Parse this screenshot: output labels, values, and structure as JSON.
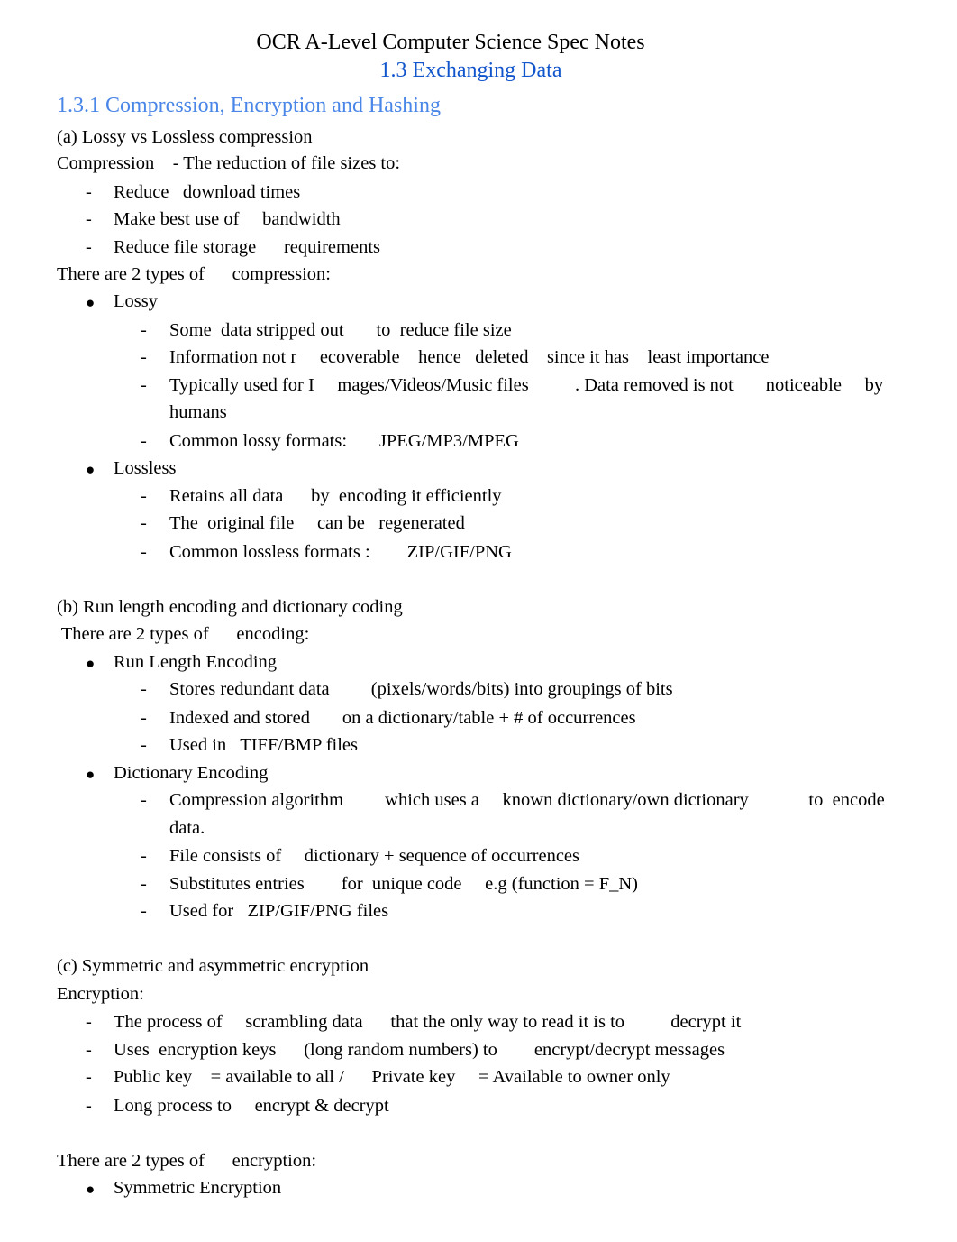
{
  "header": {
    "title": "OCR A-Level Computer Science Spec Notes",
    "subtitle": "1.3 Exchanging Data",
    "section_heading": "1.3.1 Compression, Encryption and Hashing"
  },
  "section_a": {
    "heading": "(a) Lossy vs Lossless compression",
    "intro": "Compression    - The reduction of file sizes to:",
    "reasons": [
      "Reduce   download times",
      "Make best use of     bandwidth",
      "Reduce file storage      requirements"
    ],
    "types_intro": "There are 2 types of      compression:",
    "lossy": {
      "label": "Lossy",
      "points": [
        "Some  data stripped out       to  reduce file size",
        "Information not r     ecoverable    hence   deleted    since it has    least importance",
        "Typically used for I     mages/Videos/Music files          . Data removed is not       noticeable     by",
        "humans",
        "Common lossy formats:       JPEG/MP3/MPEG"
      ]
    },
    "lossless": {
      "label": "Lossless",
      "points": [
        "Retains all data      by  encoding it efficiently",
        "The  original file     can be   regenerated",
        "Common lossless formats :        ZIP/GIF/PNG"
      ]
    }
  },
  "section_b": {
    "heading": "(b) Run length encoding and dictionary coding",
    "types_intro": " There are 2 types of      encoding:",
    "rle": {
      "label": "Run Length Encoding",
      "points": [
        "Stores redundant data         (pixels/words/bits) into groupings of bits",
        "Indexed and stored       on a dictionary/table + # of occurrences",
        "Used in   TIFF/BMP files"
      ]
    },
    "dictionary": {
      "label": "Dictionary Encoding",
      "points": [
        "Compression algorithm         which uses a     known dictionary/own dictionary             to  encode",
        "data.",
        "File consists of     dictionary + sequence of occurrences",
        "Substitutes entries        for  unique code     e.g (function = F_N)",
        "Used for   ZIP/GIF/PNG files"
      ]
    }
  },
  "section_c": {
    "heading": "(c) Symmetric and asymmetric encryption",
    "intro": "Encryption:",
    "points": [
      "The process of     scrambling data      that the only way to read it is to          decrypt it",
      "Uses  encryption keys      (long random numbers) to        encrypt/decrypt messages",
      "Public key    = available to all /      Private key     = Available to owner only",
      "Long process to     encrypt & decrypt"
    ],
    "types_intro": "There are 2 types of      encryption:",
    "symmetric": {
      "label": "Symmetric Encryption"
    }
  },
  "markers": {
    "dash": "-",
    "bullet": "●"
  },
  "colors": {
    "subtitle": "#1155cc",
    "section_heading": "#4a86e8",
    "text": "#000000"
  }
}
